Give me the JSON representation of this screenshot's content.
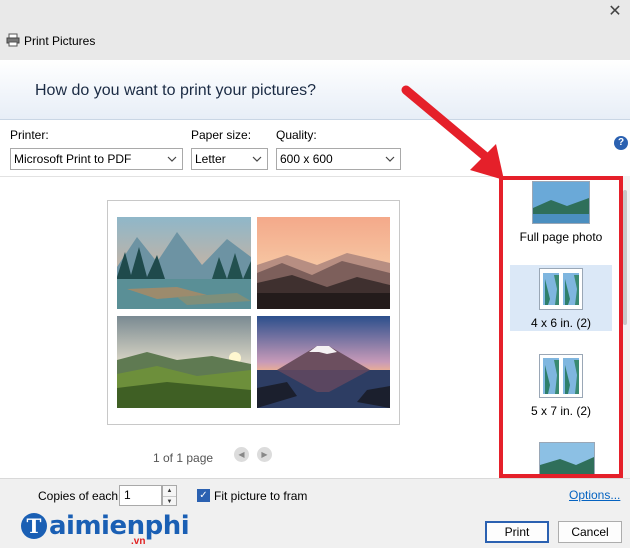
{
  "window": {
    "title": "Print Pictures",
    "close_glyph": "✕"
  },
  "header": {
    "question": "How do you want to print your pictures?"
  },
  "printer": {
    "label": "Printer:",
    "value": "Microsoft Print to PDF"
  },
  "paper_size": {
    "label": "Paper size:",
    "value": "Letter"
  },
  "quality": {
    "label": "Quality:",
    "value": "600 x 600"
  },
  "help": {
    "glyph": "?"
  },
  "preview": {
    "page_count": "1 of 1 page",
    "prev_glyph": "◀",
    "next_glyph": "▶"
  },
  "layouts": [
    {
      "label": "Full page photo",
      "selected": false
    },
    {
      "label": "4 x 6 in. (2)",
      "selected": true
    },
    {
      "label": "5 x 7 in. (2)",
      "selected": false
    }
  ],
  "footer": {
    "copies_label": "Copies of each",
    "copies_value": "1",
    "fit_label": "Fit picture to fram",
    "fit_checked": true,
    "options_link": "Options...",
    "print_button": "Print",
    "cancel_button": "Cancel"
  },
  "watermark": {
    "initial": "T",
    "text": "aimienphi",
    "suffix": ".vn"
  },
  "colors": {
    "highlight": "#e5202a",
    "accent": "#2b61b1",
    "link": "#0563c1",
    "watermark": "#1a5fb4"
  }
}
